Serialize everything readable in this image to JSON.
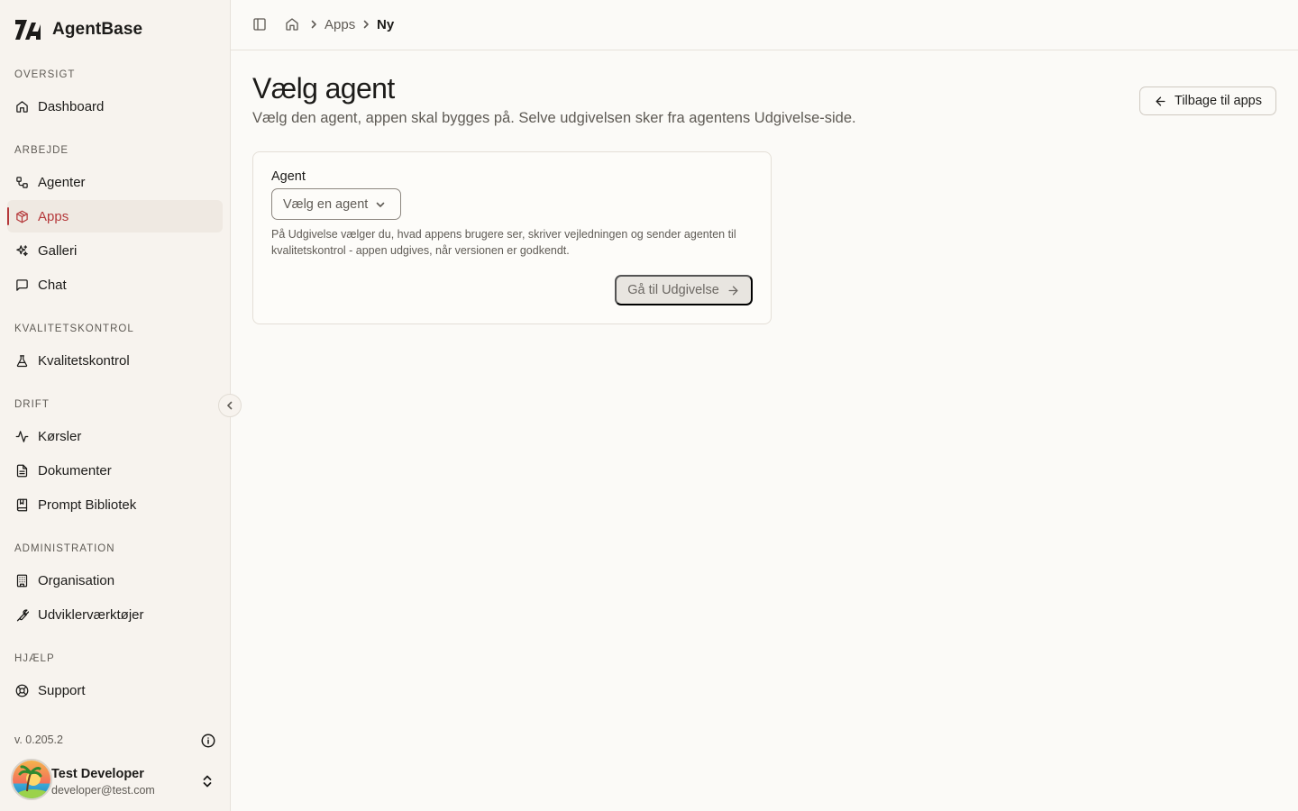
{
  "app": {
    "name": "AgentBase"
  },
  "sidebar": {
    "sections": [
      {
        "label": "OVERSIGT",
        "items": [
          {
            "label": "Dashboard",
            "icon": "home-icon"
          }
        ]
      },
      {
        "label": "ARBEJDE",
        "items": [
          {
            "label": "Agenter",
            "icon": "workflow-icon"
          },
          {
            "label": "Apps",
            "icon": "package-icon",
            "active": true
          },
          {
            "label": "Galleri",
            "icon": "sparkles-icon"
          },
          {
            "label": "Chat",
            "icon": "message-square-icon"
          }
        ]
      },
      {
        "label": "KVALITETSKONTROL",
        "items": [
          {
            "label": "Kvalitetskontrol",
            "icon": "flask-icon"
          }
        ]
      },
      {
        "label": "DRIFT",
        "items": [
          {
            "label": "Kørsler",
            "icon": "activity-icon"
          },
          {
            "label": "Dokumenter",
            "icon": "file-text-icon"
          },
          {
            "label": "Prompt Bibliotek",
            "icon": "book-icon"
          }
        ]
      },
      {
        "label": "ADMINISTRATION",
        "items": [
          {
            "label": "Organisation",
            "icon": "building-icon"
          },
          {
            "label": "Udviklerværktøjer",
            "icon": "wrench-icon"
          }
        ]
      },
      {
        "label": "HJÆLP",
        "items": [
          {
            "label": "Support",
            "icon": "life-buoy-icon"
          }
        ]
      }
    ],
    "version": "v. 0.205.2",
    "user": {
      "name": "Test Developer",
      "email": "developer@test.com"
    }
  },
  "breadcrumb": {
    "items": [
      "Apps",
      "Ny"
    ]
  },
  "page": {
    "title": "Vælg agent",
    "subtitle": "Vælg den agent, appen skal bygges på. Selve udgivelsen sker fra agentens Udgivelse-side.",
    "back_label": "Tilbage til apps"
  },
  "form": {
    "agent_label": "Agent",
    "agent_placeholder": "Vælg en agent",
    "helper": "På Udgivelse vælger du, hvad appens brugere ser, skriver vejledningen og sender agenten til kvalitetskontrol - appen udgives, når versionen er godkendt.",
    "submit_label": "Gå til Udgivelse"
  },
  "colors": {
    "accent": "#b5383a",
    "sidebar_bg": "#f7f3ee",
    "page_bg": "#fbfaf7"
  }
}
